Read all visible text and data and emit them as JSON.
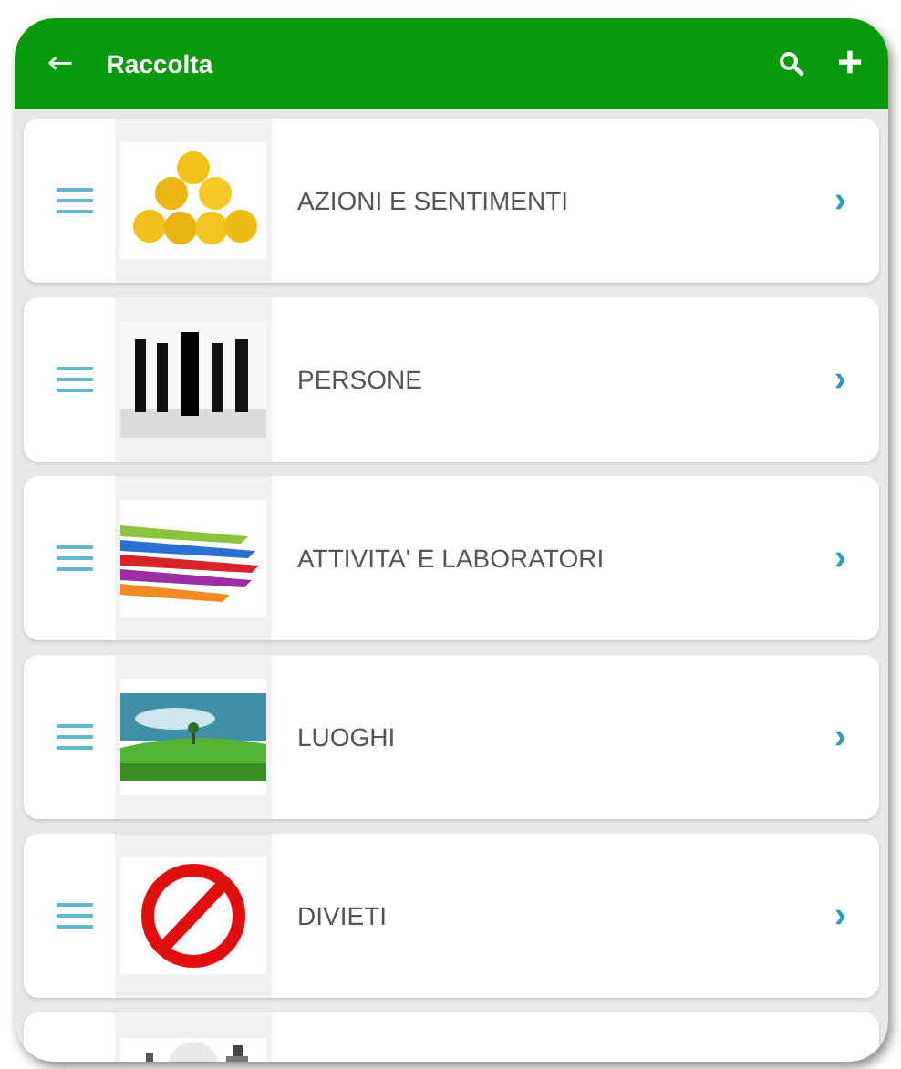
{
  "app_bar": {
    "back": "←",
    "title": "Raccolta",
    "add": "+"
  },
  "items": [
    {
      "label": "AZIONI E SENTIMENTI",
      "chevron": "›"
    },
    {
      "label": "PERSONE",
      "chevron": "›"
    },
    {
      "label": "ATTIVITA' E LABORATORI",
      "chevron": "›"
    },
    {
      "label": "LUOGHI",
      "chevron": "›"
    },
    {
      "label": "DIVIETI",
      "chevron": "›"
    }
  ]
}
